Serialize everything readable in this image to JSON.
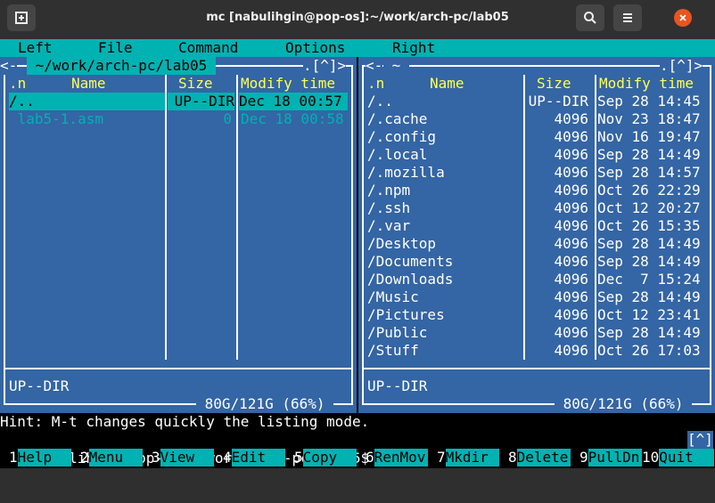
{
  "window": {
    "title": "mc [nabulihgin@pop-os]:~/work/arch-pc/lab05",
    "buttons": [
      "new-tab-icon",
      "search-icon",
      "menu-icon",
      "close-icon"
    ]
  },
  "menubar": [
    "Left",
    "File",
    "Command",
    "Options",
    "Right"
  ],
  "left_panel": {
    "corner_left": "<-",
    "path": " ~/work/arch-pc/lab05 ",
    "corner_right": ".[^]>",
    "headers": {
      "n": ".n",
      "name": "Name",
      "size": "Size",
      "mtime": "Modify time"
    },
    "files": [
      {
        "name": "/..",
        "size": "UP--DIR",
        "mtime": "Dec 18 00:57"
      },
      {
        "name": " lab5-1.asm",
        "size": "0",
        "mtime": "Dec 18 00:58"
      }
    ],
    "status": "UP--DIR",
    "disk": " 80G/121G (66%) "
  },
  "right_panel": {
    "corner_left": "<-",
    "path": " ~ ",
    "corner_right": ".[^]>",
    "headers": {
      "n": ".n",
      "name": "Name",
      "size": "Size",
      "mtime": "Modify time"
    },
    "files": [
      {
        "name": "/..",
        "size": "UP--DIR",
        "mtime": "Sep 28 14:45"
      },
      {
        "name": "/.cache",
        "size": "4096",
        "mtime": "Nov 23 18:47"
      },
      {
        "name": "/.config",
        "size": "4096",
        "mtime": "Nov 16 19:47"
      },
      {
        "name": "/.local",
        "size": "4096",
        "mtime": "Sep 28 14:49"
      },
      {
        "name": "/.mozilla",
        "size": "4096",
        "mtime": "Sep 28 14:57"
      },
      {
        "name": "/.npm",
        "size": "4096",
        "mtime": "Oct 26 22:29"
      },
      {
        "name": "/.ssh",
        "size": "4096",
        "mtime": "Oct 12 20:27"
      },
      {
        "name": "/.var",
        "size": "4096",
        "mtime": "Oct 26 15:35"
      },
      {
        "name": "/Desktop",
        "size": "4096",
        "mtime": "Sep 28 14:49"
      },
      {
        "name": "/Documents",
        "size": "4096",
        "mtime": "Sep 28 14:49"
      },
      {
        "name": "/Downloads",
        "size": "4096",
        "mtime": "Dec  7 15:24"
      },
      {
        "name": "/Music",
        "size": "4096",
        "mtime": "Sep 28 14:49"
      },
      {
        "name": "/Pictures",
        "size": "4096",
        "mtime": "Oct 12 23:41"
      },
      {
        "name": "/Public",
        "size": "4096",
        "mtime": "Sep 28 14:49"
      },
      {
        "name": "/Stuff",
        "size": "4096",
        "mtime": "Oct 26 17:03"
      }
    ],
    "status": "UP--DIR",
    "disk": " 80G/121G (66%) "
  },
  "hint": "Hint: M-t changes quickly the listing mode.",
  "prompt": "nabulihgin@pop-os:~/work/arch-pc/lab05$ ",
  "prompt_corner": "[^]",
  "fkeys": [
    {
      "num": "1",
      "label": "Help"
    },
    {
      "num": "2",
      "label": "Menu"
    },
    {
      "num": "3",
      "label": "View"
    },
    {
      "num": "4",
      "label": "Edit"
    },
    {
      "num": "5",
      "label": "Copy"
    },
    {
      "num": "6",
      "label": "RenMov"
    },
    {
      "num": "7",
      "label": "Mkdir"
    },
    {
      "num": "8",
      "label": "Delete"
    },
    {
      "num": "9",
      "label": "PullDn"
    },
    {
      "num": "10",
      "label": "Quit"
    }
  ]
}
